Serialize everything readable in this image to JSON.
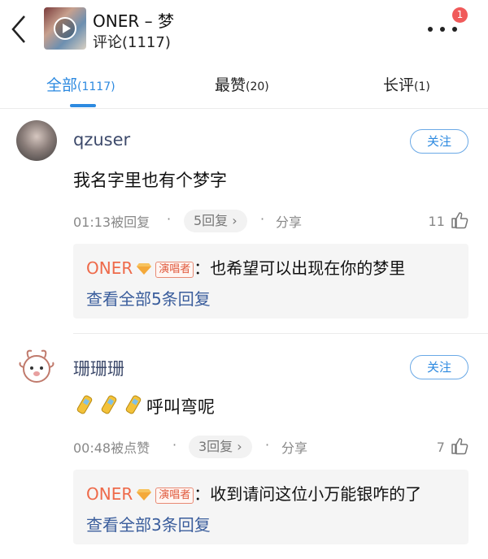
{
  "header": {
    "title": "ONER – 梦",
    "subtitle": "评论(1117)",
    "badge_count": "1"
  },
  "tabs": [
    {
      "label": "全部",
      "count": "(1117)"
    },
    {
      "label": "最赞",
      "count": "(20)"
    },
    {
      "label": "长评",
      "count": "(1)"
    }
  ],
  "comments": [
    {
      "username": "qzuser",
      "follow_label": "关注",
      "content": "我名字里也有个梦字",
      "time": "01:13被回复",
      "replies_label": "5回复 ›",
      "share_label": "分享",
      "likes": "11",
      "reply": {
        "author": "ONER",
        "role": "演唱者",
        "text": "：也希望可以出现在你的梦里",
        "view_all": "查看全部5条回复"
      }
    },
    {
      "username": "珊珊珊",
      "follow_label": "关注",
      "content": "呼叫弯呢",
      "time": "00:48被点赞",
      "replies_label": "3回复 ›",
      "share_label": "分享",
      "likes": "7",
      "reply": {
        "author": "ONER",
        "role": "演唱者",
        "text": "：收到请问这位小万能银咋的了",
        "view_all": "查看全部3条回复"
      }
    }
  ],
  "colors": {
    "accent": "#2d8ae0",
    "author": "#ee6a4a",
    "badge": "#f05a5a"
  }
}
